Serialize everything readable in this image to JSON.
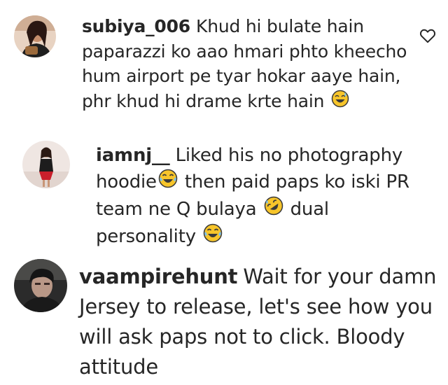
{
  "comments": [
    {
      "username": "subiya_006",
      "text": "Khud hi bulate hain paparazzi ko aao hmari phto kheecho hum airport pe tyar hokar aaye hain, phr khud hi drame krte hain",
      "trailing_emoji": "sweat-smile"
    },
    {
      "username": "iamnj__",
      "text_part1": "Liked his no photography hoodie",
      "text_part2": "then paid paps ko iski PR team ne Q bulaya",
      "text_part3": "dual personality",
      "emojis": [
        "tears-of-joy",
        "rofl",
        "tears-of-joy"
      ]
    },
    {
      "username": "vaampirehunt",
      "text": "Wait for your damn Jersey to release, let's see how you will ask paps not to click. Bloody attitude"
    }
  ],
  "colors": {
    "text": "#262626",
    "emoji_face": "#f7c52a",
    "emoji_outline": "#3a3a3a"
  }
}
